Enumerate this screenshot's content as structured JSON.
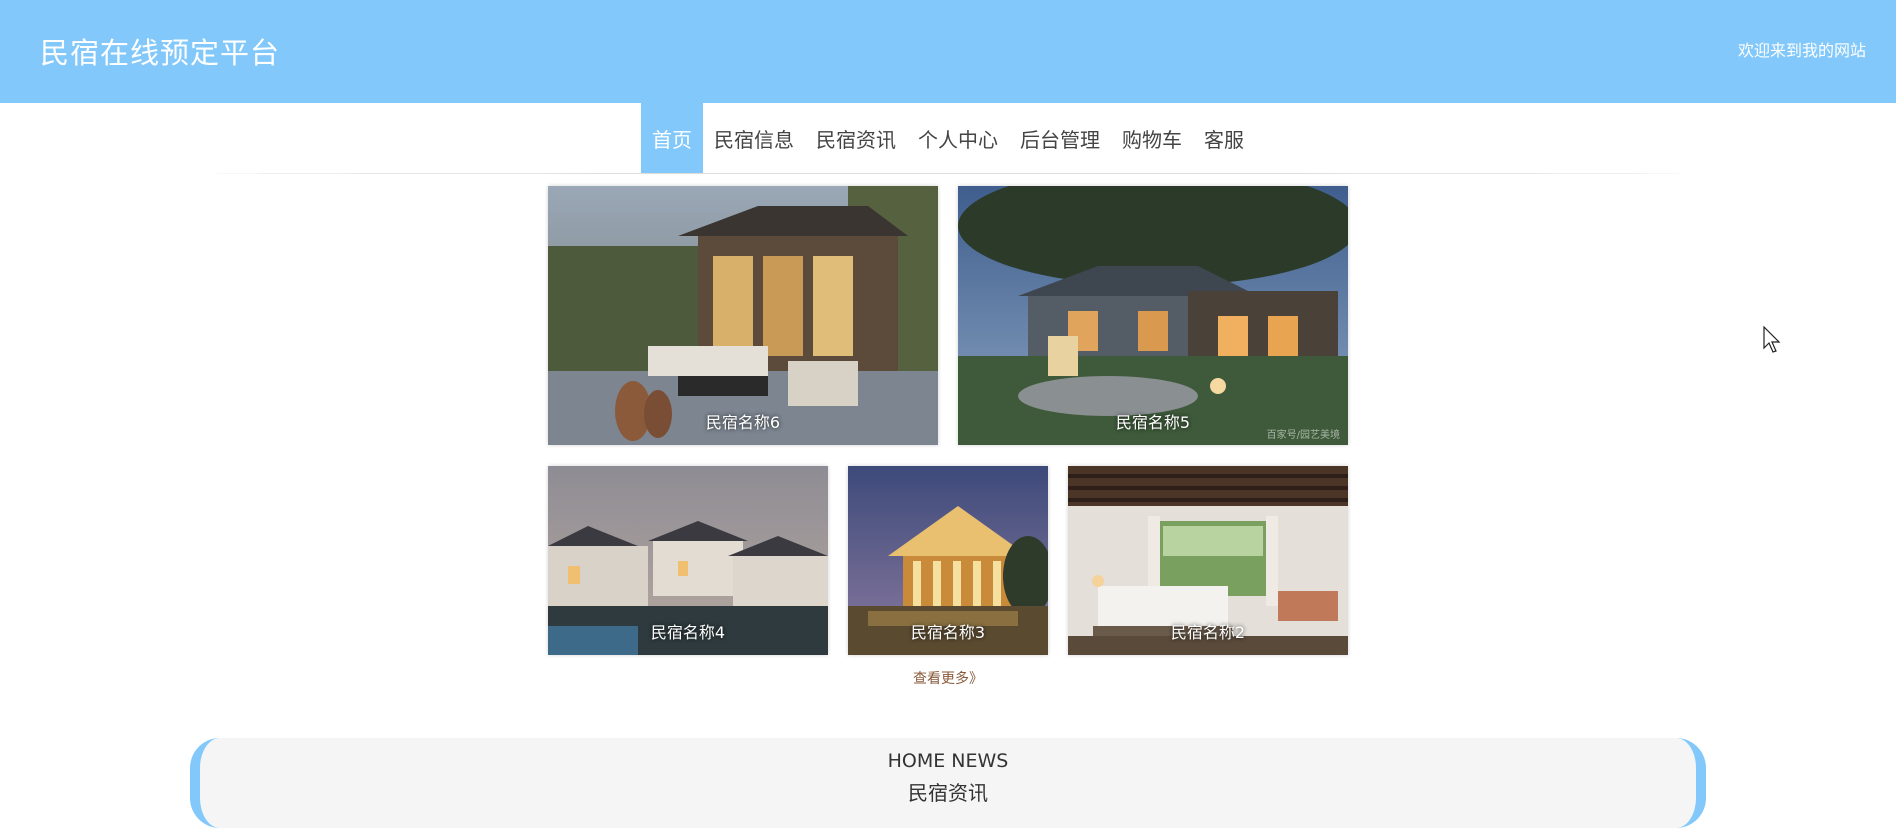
{
  "header": {
    "title": "民宿在线预定平台",
    "welcome": "欢迎来到我的网站",
    "accent_color": "#82c8fa"
  },
  "nav": {
    "items": [
      "首页",
      "民宿信息",
      "民宿资讯",
      "个人中心",
      "后台管理",
      "购物车",
      "客服"
    ],
    "active_index": 0
  },
  "featured": {
    "cards": [
      {
        "name": "民宿名称6"
      },
      {
        "name": "民宿名称5",
        "watermark": "百家号/园艺美境"
      },
      {
        "name": "民宿名称4"
      },
      {
        "name": "民宿名称3"
      },
      {
        "name": "民宿名称2"
      }
    ],
    "more_label": "查看更多》"
  },
  "news": {
    "title_en": "HOME NEWS",
    "title_cn": "民宿资讯"
  }
}
